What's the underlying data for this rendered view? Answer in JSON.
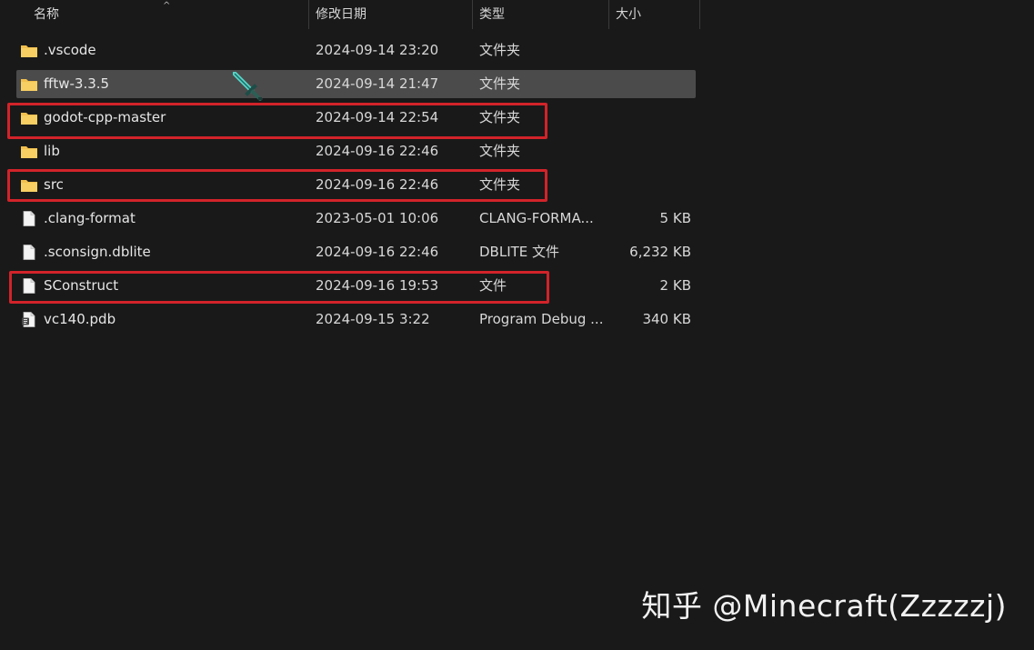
{
  "columns": {
    "name": "名称",
    "modified": "修改日期",
    "type": "类型",
    "size": "大小"
  },
  "files": [
    {
      "name": ".vscode",
      "modified": "2024-09-14 23:20",
      "type": "文件夹",
      "size": "",
      "icon": "folder-icon"
    },
    {
      "name": "fftw-3.3.5",
      "modified": "2024-09-14 21:47",
      "type": "文件夹",
      "size": "",
      "icon": "folder-icon"
    },
    {
      "name": "godot-cpp-master",
      "modified": "2024-09-14 22:54",
      "type": "文件夹",
      "size": "",
      "icon": "folder-icon"
    },
    {
      "name": "lib",
      "modified": "2024-09-16 22:46",
      "type": "文件夹",
      "size": "",
      "icon": "folder-icon"
    },
    {
      "name": "src",
      "modified": "2024-09-16 22:46",
      "type": "文件夹",
      "size": "",
      "icon": "folder-icon"
    },
    {
      "name": ".clang-format",
      "modified": "2023-05-01 10:06",
      "type": "CLANG-FORMA...",
      "size": "5 KB",
      "icon": "file-icon"
    },
    {
      "name": ".sconsign.dblite",
      "modified": "2024-09-16 22:46",
      "type": "DBLITE 文件",
      "size": "6,232 KB",
      "icon": "file-icon"
    },
    {
      "name": "SConstruct",
      "modified": "2024-09-16 19:53",
      "type": "文件",
      "size": "2 KB",
      "icon": "file-icon"
    },
    {
      "name": "vc140.pdb",
      "modified": "2024-09-15 3:22",
      "type": "Program Debug ...",
      "size": "340 KB",
      "icon": "pdb-file-icon"
    }
  ],
  "selected_row": "fftw-3.3.5",
  "highlighted_rows": [
    "godot-cpp-master",
    "src",
    "SConstruct"
  ],
  "cursor_icon": "diamond-sword-cursor-icon",
  "watermark": "知乎 @Minecraft(Zzzzzj)",
  "colors": {
    "background": "#191919",
    "selection": "#4b4b4b",
    "highlight_box": "#d2232a",
    "folder": "#f2c04e"
  }
}
